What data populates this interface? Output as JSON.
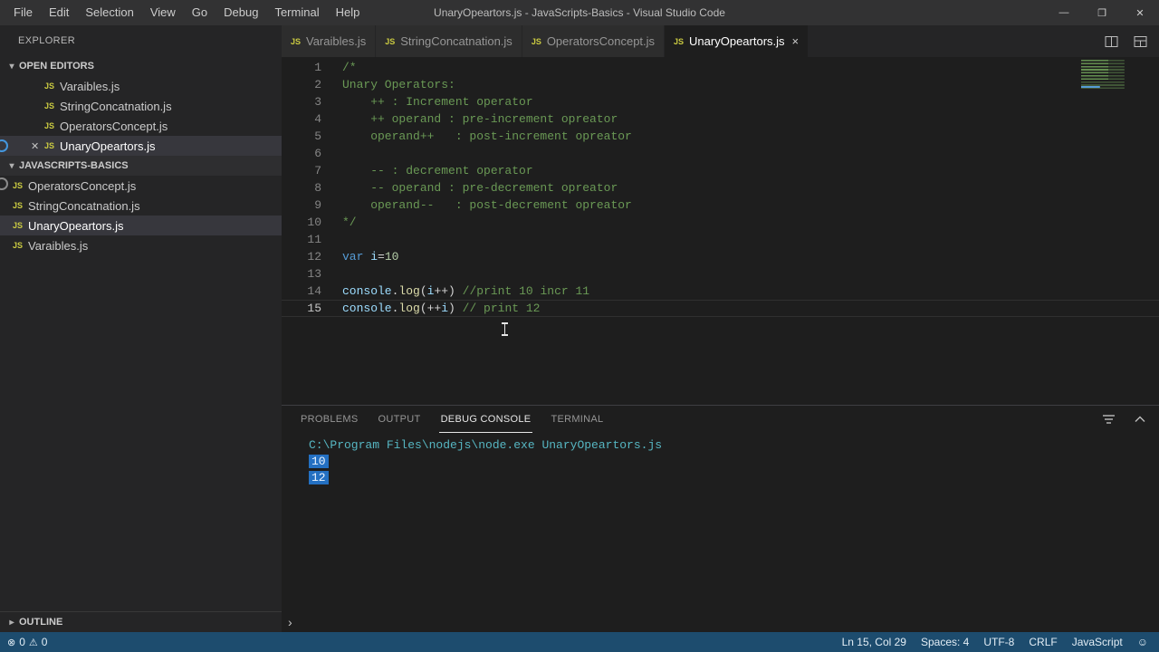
{
  "colors": {
    "statusbar": "#1d4c6e",
    "selection": "#2470c2",
    "comment": "#6a9955",
    "keyword": "#569cd6",
    "variable": "#9cdcfe",
    "number": "#b5cea8",
    "function": "#dcdcaa",
    "js_icon": "#cbcb41",
    "console_info": "#56b6c2"
  },
  "icons": {
    "js": "JS",
    "close_tab": "×",
    "close_window": "✕",
    "minimize": "—",
    "maximize": "❐",
    "twisty_open": "▾",
    "twisty_closed": "▸",
    "error": "⊗",
    "warning": "⚠",
    "smiley": "☺",
    "prompt": "›"
  },
  "title_bar": {
    "menus": [
      "File",
      "Edit",
      "Selection",
      "View",
      "Go",
      "Debug",
      "Terminal",
      "Help"
    ],
    "title": "UnaryOpeartors.js - JavaScripts-Basics - Visual Studio Code"
  },
  "sidebar": {
    "header": "EXPLORER",
    "open_editors": {
      "label": "OPEN EDITORS",
      "items": [
        {
          "label": "Varaibles.js"
        },
        {
          "label": "StringConcatnation.js"
        },
        {
          "label": "OperatorsConcept.js"
        },
        {
          "label": "UnaryOpeartors.js",
          "active": true
        }
      ]
    },
    "folder": {
      "label": "JAVASCRIPTS-BASICS",
      "items": [
        {
          "label": "OperatorsConcept.js"
        },
        {
          "label": "StringConcatnation.js"
        },
        {
          "label": "UnaryOpeartors.js",
          "selected": true
        },
        {
          "label": "Varaibles.js"
        }
      ]
    },
    "outline_label": "OUTLINE"
  },
  "tabs": [
    {
      "label": "Varaibles.js"
    },
    {
      "label": "StringConcatnation.js"
    },
    {
      "label": "OperatorsConcept.js"
    },
    {
      "label": "UnaryOpeartors.js",
      "active": true
    }
  ],
  "editor": {
    "lines": [
      {
        "n": "1",
        "segs": [
          [
            "com",
            "/*"
          ]
        ]
      },
      {
        "n": "2",
        "segs": [
          [
            "com",
            "Unary Operators:"
          ]
        ]
      },
      {
        "n": "3",
        "segs": [
          [
            "com",
            "    ++ : Increment operator"
          ]
        ]
      },
      {
        "n": "4",
        "segs": [
          [
            "com",
            "    ++ operand : pre-increment opreator"
          ]
        ]
      },
      {
        "n": "5",
        "segs": [
          [
            "com",
            "    operand++   : post-increment opreator"
          ]
        ]
      },
      {
        "n": "6",
        "segs": []
      },
      {
        "n": "7",
        "segs": [
          [
            "com",
            "    -- : decrement operator"
          ]
        ]
      },
      {
        "n": "8",
        "segs": [
          [
            "com",
            "    -- operand : pre-decrement opreator"
          ]
        ]
      },
      {
        "n": "9",
        "segs": [
          [
            "com",
            "    operand--   : post-decrement opreator"
          ]
        ]
      },
      {
        "n": "10",
        "segs": [
          [
            "com",
            "*/"
          ]
        ]
      },
      {
        "n": "11",
        "segs": []
      },
      {
        "n": "12",
        "segs": [
          [
            "kw",
            "var"
          ],
          [
            "pln",
            " "
          ],
          [
            "var",
            "i"
          ],
          [
            "pln",
            "="
          ],
          [
            "num",
            "10"
          ]
        ]
      },
      {
        "n": "13",
        "segs": []
      },
      {
        "n": "14",
        "segs": [
          [
            "var",
            "console"
          ],
          [
            "pln",
            "."
          ],
          [
            "fn",
            "log"
          ],
          [
            "pln",
            "("
          ],
          [
            "var",
            "i"
          ],
          [
            "pln",
            "++) "
          ],
          [
            "com",
            "//print 10 incr 11"
          ]
        ]
      },
      {
        "n": "15",
        "segs": [
          [
            "var",
            "console"
          ],
          [
            "pln",
            "."
          ],
          [
            "fn",
            "log"
          ],
          [
            "pln",
            "(++"
          ],
          [
            "var",
            "i"
          ],
          [
            "pln",
            ") "
          ],
          [
            "com",
            "// print 12"
          ]
        ],
        "current": true
      }
    ]
  },
  "panel": {
    "tabs": [
      {
        "label": "PROBLEMS"
      },
      {
        "label": "OUTPUT"
      },
      {
        "label": "DEBUG CONSOLE",
        "active": true
      },
      {
        "label": "TERMINAL"
      }
    ],
    "console_lines": [
      {
        "text": "C:\\Program Files\\nodejs\\node.exe UnaryOpeartors.js",
        "style": "info"
      },
      {
        "text": "10",
        "style": "value",
        "selected": true
      },
      {
        "text": "12",
        "style": "value",
        "selected": true
      }
    ],
    "prompt": "›"
  },
  "status_bar": {
    "errors": "0",
    "warnings": "0",
    "cursor": "Ln 15, Col 29",
    "indent": "Spaces: 4",
    "encoding": "UTF-8",
    "eol": "CRLF",
    "language": "JavaScript"
  }
}
